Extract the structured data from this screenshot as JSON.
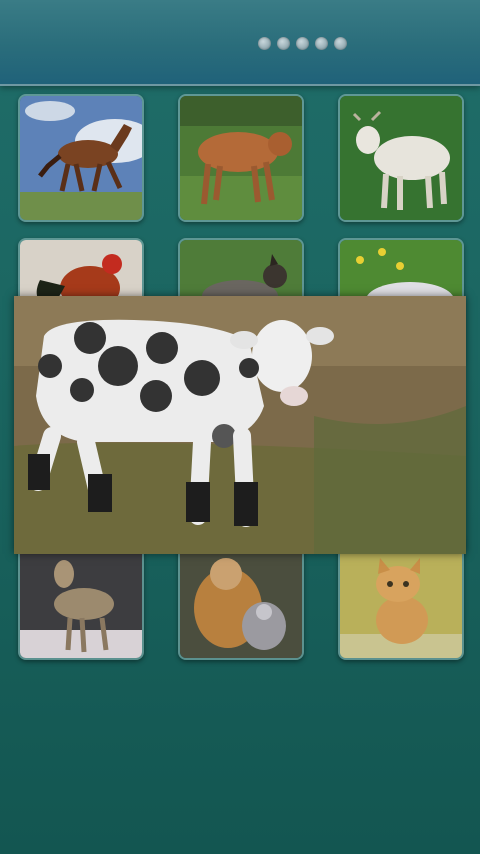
{
  "pager": {
    "page_count": 5,
    "current_page": 1
  },
  "grid": {
    "tiles": [
      {
        "name": "horse",
        "icon": "horse-photo"
      },
      {
        "name": "cow",
        "icon": "cow-photo"
      },
      {
        "name": "goat",
        "icon": "goat-photo"
      },
      {
        "name": "rooster",
        "icon": "rooster-photo"
      },
      {
        "name": "dog",
        "icon": "dog-photo"
      },
      {
        "name": "sheep",
        "icon": "sheep-photo"
      },
      {
        "name": "wolf",
        "icon": "wolf-photo"
      },
      {
        "name": "monkey",
        "icon": "monkey-photo"
      },
      {
        "name": "cat",
        "icon": "cat-photo"
      }
    ]
  },
  "popup": {
    "animal": "spotted-cow",
    "icon": "spotted-cow-photo"
  },
  "colors": {
    "background": "#1b6661",
    "topbar": "#2a6d7b",
    "dot": "#8ea6ae"
  }
}
